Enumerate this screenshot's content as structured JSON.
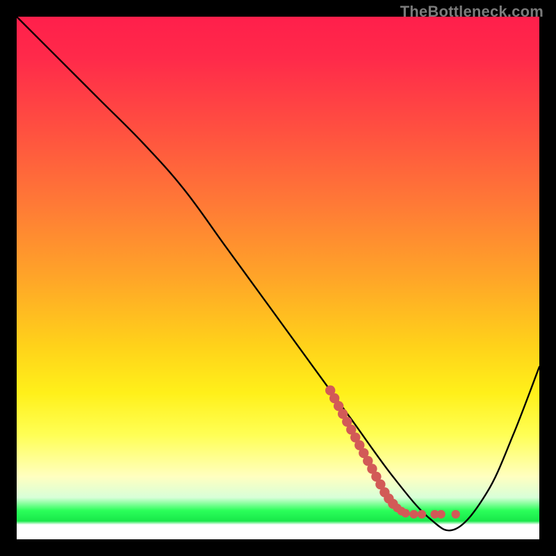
{
  "watermark": "TheBottleneck.com",
  "colors": {
    "background": "#000000",
    "curve": "#000000",
    "marker": "#d25a57"
  },
  "chart_data": {
    "type": "line",
    "title": "",
    "xlabel": "",
    "ylabel": "",
    "xlim": [
      0,
      100
    ],
    "ylim": [
      0,
      100
    ],
    "grid": false,
    "legend": false,
    "series": [
      {
        "name": "bottleneck-curve",
        "x": [
          0,
          8,
          16,
          24,
          32,
          40,
          48,
          56,
          64,
          72,
          79,
          84,
          90,
          95,
          100
        ],
        "y": [
          100,
          92,
          84,
          76,
          67,
          56,
          45,
          34,
          23,
          12,
          4,
          2,
          9,
          20,
          33
        ]
      }
    ],
    "markers": {
      "name": "highlight-dots",
      "color": "#d25a57",
      "points": [
        {
          "x": 60.0,
          "y": 28.5
        },
        {
          "x": 60.8,
          "y": 27.0
        },
        {
          "x": 61.6,
          "y": 25.5
        },
        {
          "x": 62.4,
          "y": 24.0
        },
        {
          "x": 63.2,
          "y": 22.5
        },
        {
          "x": 64.0,
          "y": 21.0
        },
        {
          "x": 64.8,
          "y": 19.5
        },
        {
          "x": 65.6,
          "y": 18.0
        },
        {
          "x": 66.4,
          "y": 16.5
        },
        {
          "x": 67.2,
          "y": 15.0
        },
        {
          "x": 68.0,
          "y": 13.5
        },
        {
          "x": 68.8,
          "y": 12.0
        },
        {
          "x": 69.6,
          "y": 10.5
        },
        {
          "x": 70.4,
          "y": 9.0
        },
        {
          "x": 71.2,
          "y": 7.8
        },
        {
          "x": 72.0,
          "y": 6.8
        },
        {
          "x": 72.8,
          "y": 6.0
        },
        {
          "x": 73.6,
          "y": 5.4
        },
        {
          "x": 74.4,
          "y": 5.0
        },
        {
          "x": 76.0,
          "y": 4.8
        },
        {
          "x": 77.5,
          "y": 4.8
        },
        {
          "x": 80.0,
          "y": 4.8
        },
        {
          "x": 81.2,
          "y": 4.8
        },
        {
          "x": 84.0,
          "y": 4.8
        }
      ]
    }
  }
}
